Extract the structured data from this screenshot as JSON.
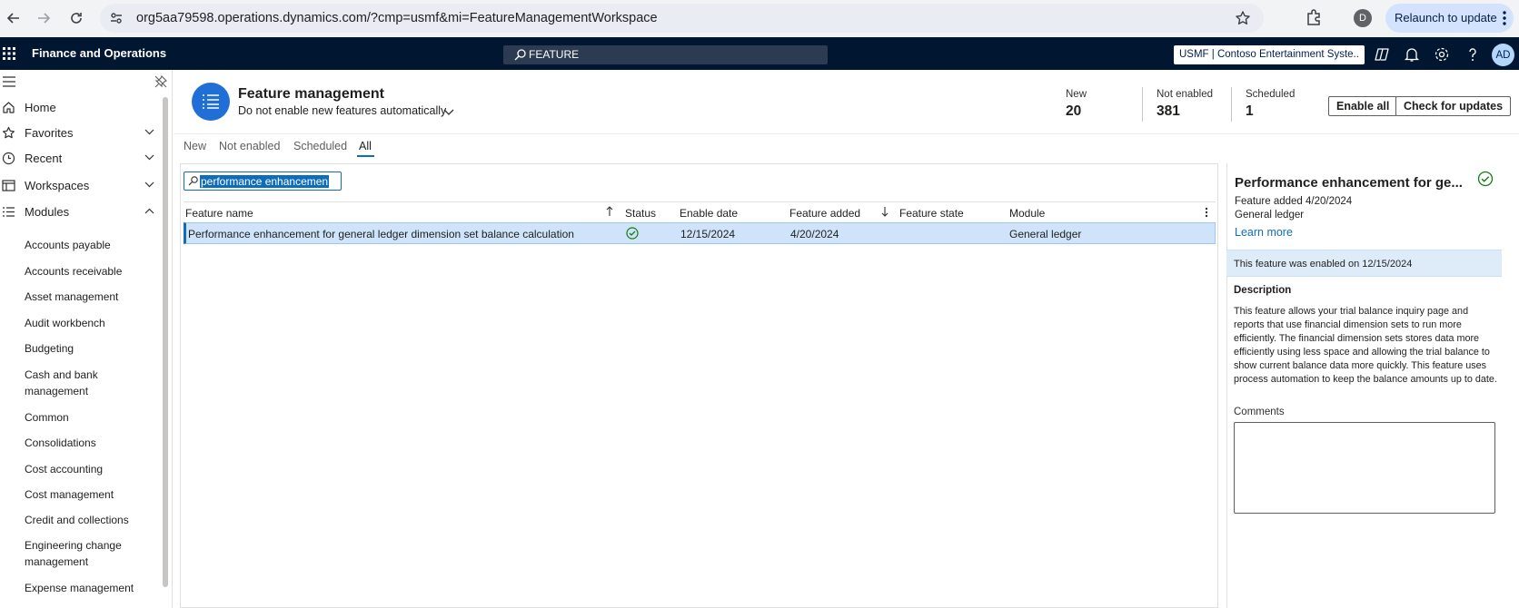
{
  "browser": {
    "url": "org5aa79598.operations.dynamics.com/?cmp=usmf&mi=FeatureManagementWorkspace",
    "profile_initial": "D",
    "relaunch_label": "Relaunch to update"
  },
  "app": {
    "title": "Finance and Operations",
    "search_value": "FEATURE",
    "company": "USMF | Contoso Entertainment Syste...",
    "avatar_initials": "AD"
  },
  "sidebar": {
    "nav": [
      {
        "label": "Home",
        "icon": "home-icon"
      },
      {
        "label": "Favorites",
        "icon": "star-icon"
      },
      {
        "label": "Recent",
        "icon": "clock-icon"
      },
      {
        "label": "Workspaces",
        "icon": "workspace-icon"
      },
      {
        "label": "Modules",
        "icon": "list-icon"
      }
    ],
    "modules": [
      "Accounts payable",
      "Accounts receivable",
      "Asset management",
      "Audit workbench",
      "Budgeting",
      "Cash and bank management",
      "Common",
      "Consolidations",
      "Cost accounting",
      "Cost management",
      "Credit and collections",
      "Engineering change management",
      "Expense management"
    ]
  },
  "page": {
    "title": "Feature management",
    "subtitle": "Do not enable new features automatically",
    "kpis": [
      {
        "label": "New",
        "value": "20"
      },
      {
        "label": "Not enabled",
        "value": "381"
      },
      {
        "label": "Scheduled",
        "value": "1"
      }
    ],
    "buttons": {
      "enable_all": "Enable all",
      "check_updates": "Check for updates"
    }
  },
  "tabs": [
    "New",
    "Not enabled",
    "Scheduled",
    "All"
  ],
  "active_tab": "All",
  "grid": {
    "filter_value": "performance enhancemen",
    "columns": [
      "Feature name",
      "Status",
      "Enable date",
      "Feature added",
      "Feature state",
      "Module"
    ],
    "rows": [
      {
        "feature_name": "Performance enhancement for general ledger dimension set balance calculation",
        "status": "enabled",
        "enable_date": "12/15/2024",
        "feature_added": "4/20/2024",
        "feature_state": "",
        "module": "General ledger"
      }
    ]
  },
  "details": {
    "title": "Performance enhancement for ge...",
    "feature_added": "Feature added 4/20/2024",
    "module": "General ledger",
    "learn_more": "Learn more",
    "banner": "This feature was enabled on 12/15/2024",
    "description_heading": "Description",
    "description": "This feature allows your trial balance inquiry page and reports that use financial dimension sets to run more efficiently. The financial dimension sets stores data more efficiently using less space and allowing the trial balance to show current balance data more quickly. This feature uses process automation to keep the balance amounts up to date.",
    "comments_label": "Comments",
    "comments_value": ""
  },
  "colors": {
    "appbar": "#001631",
    "accent": "#0f6cbd",
    "selected_row": "#cfe4fa",
    "banner": "#deecf9",
    "success": "#107c10"
  }
}
